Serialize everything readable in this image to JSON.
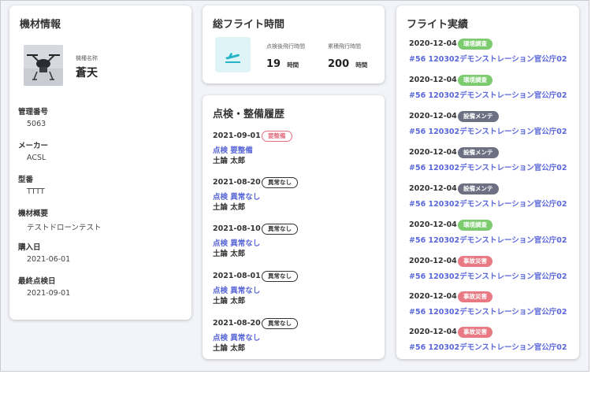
{
  "equipment": {
    "title": "機材情報",
    "model_name_label": "機種名称",
    "model_name": "蒼天",
    "fields": [
      {
        "label": "管理番号",
        "value": "5063"
      },
      {
        "label": "メーカー",
        "value": "ACSL"
      },
      {
        "label": "型番",
        "value": "TTTT"
      },
      {
        "label": "機材概要",
        "value": "テストドローンテスト"
      },
      {
        "label": "購入日",
        "value": "2021-06-01"
      },
      {
        "label": "最終点検日",
        "value": "2021-09-01"
      }
    ]
  },
  "flight_time": {
    "title": "総フライト時間",
    "stats": [
      {
        "label": "点検後飛行時間",
        "value": "19",
        "unit": "時間"
      },
      {
        "label": "累積飛行時間",
        "value": "200",
        "unit": "時間"
      }
    ]
  },
  "maintenance": {
    "title": "点検・整備履歴",
    "items": [
      {
        "date": "2021-09-01",
        "badge": "要整備",
        "link": "点検 要整備",
        "person": "土論 太郎"
      },
      {
        "date": "2021-08-20",
        "badge": "異常なし",
        "link": "点検 異常なし",
        "person": "土論 太郎"
      },
      {
        "date": "2021-08-10",
        "badge": "異常なし",
        "link": "点検 異常なし",
        "person": "土論 太郎"
      },
      {
        "date": "2021-08-01",
        "badge": "異常なし",
        "link": "点検 異常なし",
        "person": "土論 太郎"
      },
      {
        "date": "2021-08-20",
        "badge": "異常なし",
        "link": "点検 異常なし",
        "person": "土論 太郎"
      }
    ]
  },
  "flights": {
    "title": "フライト実績",
    "items": [
      {
        "date": "2020-12-04",
        "badge": "環境調査",
        "link": "#56 120302デモンストレーション官公庁02"
      },
      {
        "date": "2020-12-04",
        "badge": "環境調査",
        "link": "#56 120302デモンストレーション官公庁02"
      },
      {
        "date": "2020-12-04",
        "badge": "設備メンテ",
        "link": "#56 120302デモンストレーション官公庁02"
      },
      {
        "date": "2020-12-04",
        "badge": "設備メンテ",
        "link": "#56 120302デモンストレーション官公庁02"
      },
      {
        "date": "2020-12-04",
        "badge": "設備メンテ",
        "link": "#56 120302デモンストレーション官公庁02"
      },
      {
        "date": "2020-12-04",
        "badge": "環境調査",
        "link": "#56 120302デモンストレーション官公庁02"
      },
      {
        "date": "2020-12-04",
        "badge": "事故災害",
        "link": "#56 120302デモンストレーション官公庁02"
      },
      {
        "date": "2020-12-04",
        "badge": "事故災害",
        "link": "#56 120302デモンストレーション官公庁02"
      },
      {
        "date": "2020-12-04",
        "badge": "事故災害",
        "link": "#56 120302デモンストレーション官公庁02"
      }
    ]
  },
  "colors": {
    "link": "#5a67d8",
    "badge_env": "#7ccc6f",
    "badge_maint": "#6c7082",
    "badge_accident": "#e97a83",
    "badge_needs_service": "#e3707f",
    "flight_icon_bg": "#dff4f6",
    "flight_icon": "#26b5c7"
  },
  "icons": {
    "drone": "drone-photo-icon",
    "flight": "airplane-takeoff-icon"
  }
}
